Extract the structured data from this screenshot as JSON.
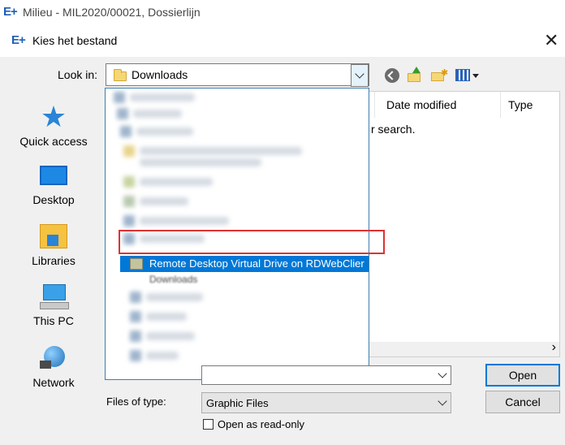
{
  "outer_window": {
    "logo": "E+",
    "title": "Milieu - MIL2020/00021, Dossierlijn"
  },
  "dialog": {
    "logo": "E+",
    "title": "Kies het bestand",
    "close": "✕",
    "look_in_label": "Look in:",
    "look_in_value": "Downloads",
    "places": [
      {
        "label": "Quick access",
        "icon": "star-icon"
      },
      {
        "label": "Desktop",
        "icon": "desktop-icon"
      },
      {
        "label": "Libraries",
        "icon": "libraries-icon"
      },
      {
        "label": "This PC",
        "icon": "pc-icon"
      },
      {
        "label": "Network",
        "icon": "network-icon"
      }
    ],
    "columns": {
      "date_modified": "Date modified",
      "type": "Type"
    },
    "empty_message_fragment": "r search.",
    "dropdown": {
      "highlighted_item": "Remote Desktop Virtual Drive on RDWebClier",
      "below_item": "Downloads"
    },
    "file_name_value": "",
    "files_of_type_label": "Files of type:",
    "files_of_type_value": "Graphic Files",
    "readonly_label": "Open as read-only",
    "open_button": "Open",
    "cancel_button": "Cancel",
    "scroll_right": "›"
  },
  "colors": {
    "accent": "#0078d7",
    "highlight_box": "#dd3333"
  }
}
